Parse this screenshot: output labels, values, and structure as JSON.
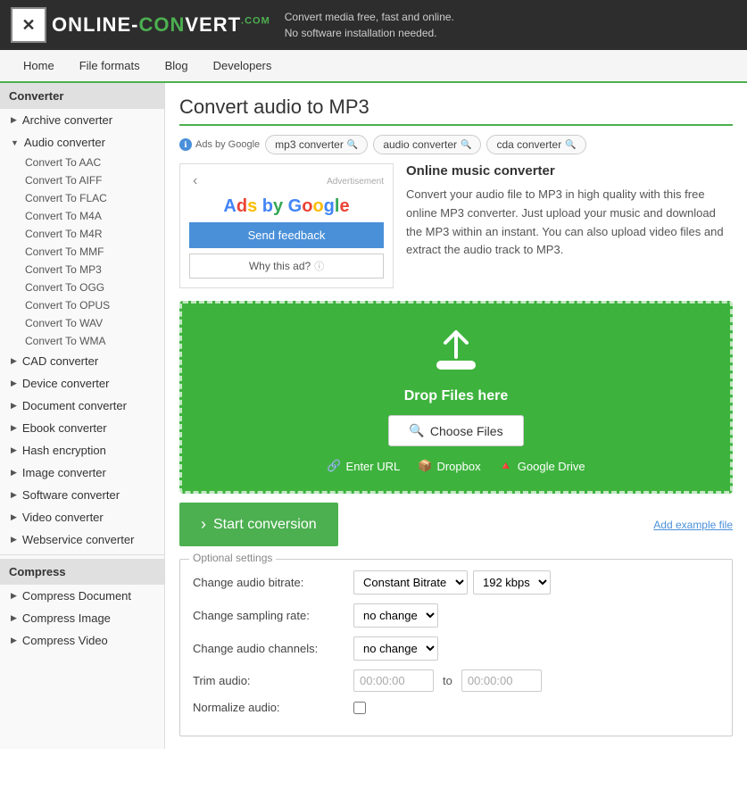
{
  "header": {
    "logo_text_before": "ONLINE-",
    "logo_text_after": "VERT",
    "logo_com": ".COM",
    "tagline_line1": "Convert media free, fast and online.",
    "tagline_line2": "No software installation needed."
  },
  "nav": {
    "items": [
      "Home",
      "File formats",
      "Blog",
      "Developers"
    ]
  },
  "sidebar": {
    "section_converter": "Converter",
    "items_converter": [
      {
        "label": "Archive converter",
        "type": "arrow",
        "open": false
      },
      {
        "label": "Audio converter",
        "type": "arrow",
        "open": true
      },
      {
        "label": "CAD converter",
        "type": "arrow",
        "open": false
      },
      {
        "label": "Device converter",
        "type": "arrow",
        "open": false
      },
      {
        "label": "Document converter",
        "type": "arrow",
        "open": false
      },
      {
        "label": "Ebook converter",
        "type": "arrow",
        "open": false
      },
      {
        "label": "Hash encryption",
        "type": "arrow",
        "open": false
      },
      {
        "label": "Image converter",
        "type": "arrow",
        "open": false
      },
      {
        "label": "Software converter",
        "type": "arrow",
        "open": false
      },
      {
        "label": "Video converter",
        "type": "arrow",
        "open": false
      },
      {
        "label": "Webservice converter",
        "type": "arrow",
        "open": false
      }
    ],
    "sub_audio": [
      "Convert To AAC",
      "Convert To AIFF",
      "Convert To FLAC",
      "Convert To M4A",
      "Convert To M4R",
      "Convert To MMF",
      "Convert To MP3",
      "Convert To OGG",
      "Convert To OPUS",
      "Convert To WAV",
      "Convert To WMA"
    ],
    "section_compress": "Compress",
    "items_compress": [
      {
        "label": "Compress Document",
        "type": "arrow"
      },
      {
        "label": "Compress Image",
        "type": "arrow"
      },
      {
        "label": "Compress Video",
        "type": "arrow"
      }
    ]
  },
  "content": {
    "page_title": "Convert audio to MP3",
    "tabs": [
      {
        "label": "mp3 converter",
        "has_search": true
      },
      {
        "label": "audio converter",
        "has_search": true
      },
      {
        "label": "cda converter",
        "has_search": true
      }
    ],
    "ads_label": "Ads by Google",
    "advertisement": "Advertisement",
    "ad_send_feedback": "Send feedback",
    "ad_why": "Why this ad?",
    "info_title": "Online music converter",
    "info_text": "Convert your audio file to MP3 in high quality with this free online MP3 converter. Just upload your music and download the MP3 within an instant. You can also upload video files and extract the audio track to MP3.",
    "drop_zone": {
      "drop_text": "Drop Files here",
      "choose_files": "Choose Files",
      "enter_url": "Enter URL",
      "dropbox": "Dropbox",
      "google_drive": "Google Drive"
    },
    "start_conversion": "Start conversion",
    "add_example_file": "Add example file",
    "optional_settings_label": "Optional settings",
    "settings": [
      {
        "label": "Change audio bitrate:",
        "controls": [
          {
            "type": "select",
            "options": [
              "Constant Bitrate"
            ],
            "selected": "Constant Bitrate"
          },
          {
            "type": "select",
            "options": [
              "192 kbps"
            ],
            "selected": "192 kbps"
          }
        ]
      },
      {
        "label": "Change sampling rate:",
        "controls": [
          {
            "type": "select",
            "options": [
              "no change"
            ],
            "selected": "no change"
          }
        ]
      },
      {
        "label": "Change audio channels:",
        "controls": [
          {
            "type": "select",
            "options": [
              "no change"
            ],
            "selected": "no change"
          }
        ]
      },
      {
        "label": "Trim audio:",
        "controls": [
          {
            "type": "text",
            "value": "00:00:00",
            "placeholder": "00:00:00"
          },
          {
            "type": "to"
          },
          {
            "type": "text",
            "value": "00:00:00",
            "placeholder": "00:00:00"
          }
        ]
      },
      {
        "label": "Normalize audio:",
        "controls": [
          {
            "type": "checkbox"
          }
        ]
      }
    ]
  },
  "colors": {
    "green": "#4caf50",
    "dark_green": "#3db33d",
    "blue": "#4a90d9"
  }
}
